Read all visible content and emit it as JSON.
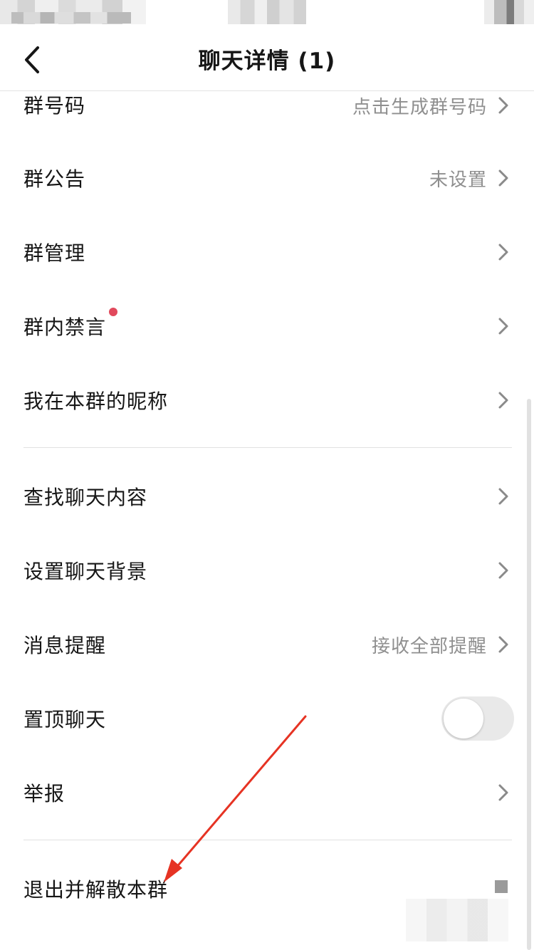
{
  "nav": {
    "title": "聊天详情 (1)"
  },
  "section1": [
    {
      "label": "群号码",
      "value": "点击生成群号码"
    },
    {
      "label": "群公告",
      "value": "未设置"
    },
    {
      "label": "群管理",
      "value": ""
    },
    {
      "label": "群内禁言",
      "value": ""
    },
    {
      "label": "我在本群的昵称",
      "value": ""
    }
  ],
  "section2": [
    {
      "label": "查找聊天内容",
      "value": ""
    },
    {
      "label": "设置聊天背景",
      "value": ""
    },
    {
      "label": "消息提醒",
      "value": "接收全部提醒"
    },
    {
      "label": "置顶聊天",
      "toggle_on": false
    },
    {
      "label": "举报",
      "value": ""
    }
  ],
  "section3": [
    {
      "label": "退出并解散本群"
    }
  ],
  "colors": {
    "badge": "#e1495c",
    "annotation_arrow": "#e63323",
    "secondary_text": "#8f8f8f"
  },
  "icons": {
    "back": "chevron-left-icon",
    "row": "chevron-right-icon"
  }
}
